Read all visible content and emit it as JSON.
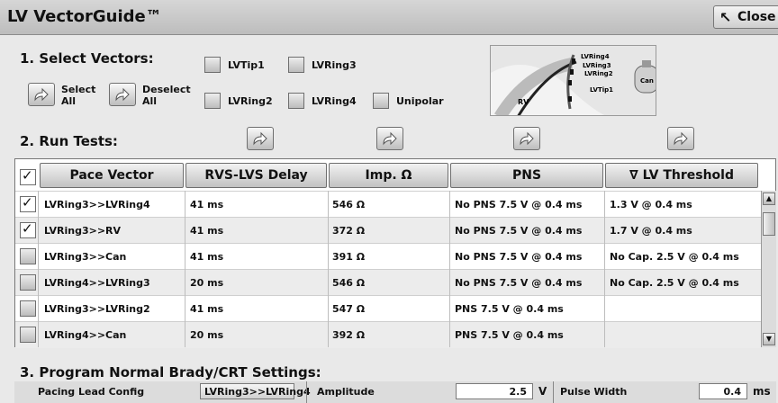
{
  "window": {
    "title": "LV VectorGuide™",
    "close_label": "Close"
  },
  "select_vectors": {
    "heading": "1. Select Vectors:",
    "select_all_label": "Select\nAll",
    "deselect_all_label": "Deselect\nAll",
    "checkboxes": [
      {
        "label": "LVTip1",
        "checked": false
      },
      {
        "label": "LVRing3",
        "checked": false
      },
      {
        "label": "LVRing2",
        "checked": false
      },
      {
        "label": "LVRing4",
        "checked": false
      },
      {
        "label": "Unipolar",
        "checked": false
      }
    ]
  },
  "diagram": {
    "labels": [
      "LVRing4",
      "LVRing3",
      "LVRing2",
      "LVTip1",
      "Can",
      "RV"
    ]
  },
  "run_tests": {
    "heading": "2. Run Tests:"
  },
  "table": {
    "header_checked": true,
    "columns": [
      "Pace Vector",
      "RVS-LVS Delay",
      "Imp. Ω",
      "PNS",
      "LV Threshold"
    ],
    "sort_icon": "triangle-down-icon",
    "rows": [
      {
        "checked": true,
        "vector": "LVRing3>>LVRing4",
        "delay": "41 ms",
        "imp": "546 Ω",
        "pns": "No PNS 7.5 V @ 0.4 ms",
        "threshold": "1.3 V @ 0.4 ms"
      },
      {
        "checked": true,
        "vector": "LVRing3>>RV",
        "delay": "41 ms",
        "imp": "372 Ω",
        "pns": "No PNS 7.5 V @ 0.4 ms",
        "threshold": "1.7 V @ 0.4 ms"
      },
      {
        "checked": false,
        "vector": "LVRing3>>Can",
        "delay": "41 ms",
        "imp": "391 Ω",
        "pns": "No PNS 7.5 V @ 0.4 ms",
        "threshold": "No Cap. 2.5 V @ 0.4 ms"
      },
      {
        "checked": false,
        "vector": "LVRing4>>LVRing3",
        "delay": "20 ms",
        "imp": "546 Ω",
        "pns": "No PNS 7.5 V @ 0.4 ms",
        "threshold": "No Cap. 2.5 V @ 0.4 ms"
      },
      {
        "checked": false,
        "vector": "LVRing3>>LVRing2",
        "delay": "41 ms",
        "imp": "547 Ω",
        "pns": "PNS 7.5 V @ 0.4 ms",
        "threshold": ""
      },
      {
        "checked": false,
        "vector": "LVRing4>>Can",
        "delay": "20 ms",
        "imp": "392 Ω",
        "pns": "PNS 7.5 V @ 0.4 ms",
        "threshold": ""
      }
    ]
  },
  "program": {
    "heading": "3. Program Normal Brady/CRT Settings:",
    "pacing_lead_config_label": "Pacing Lead Config",
    "pacing_lead_config_value": "LVRing3>>LVRing4",
    "amplitude_label": "Amplitude",
    "amplitude_value": "2.5",
    "amplitude_unit": "V",
    "pulse_width_label": "Pulse Width",
    "pulse_width_value": "0.4",
    "pulse_width_unit": "ms"
  }
}
